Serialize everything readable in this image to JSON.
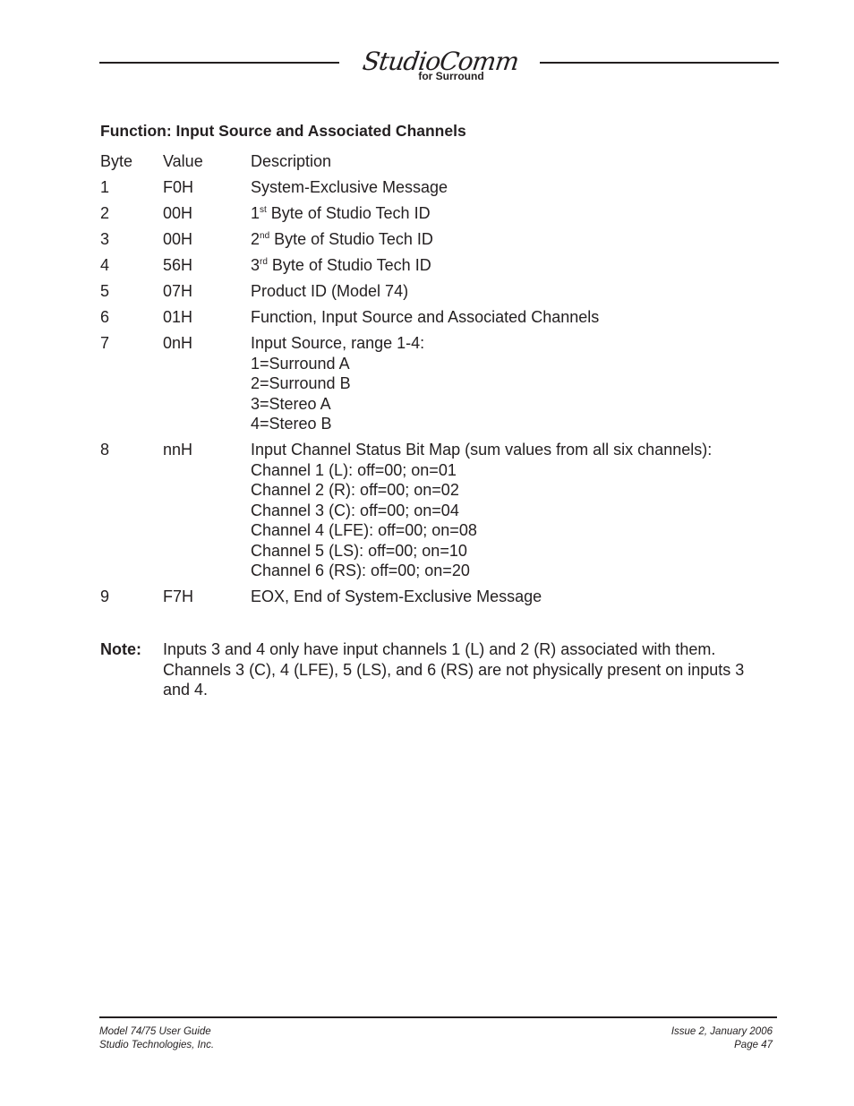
{
  "header": {
    "logo_script": "StudioComm",
    "logo_sub": "for Surround"
  },
  "section_title": "Function: Input Source and Associated Channels",
  "table": {
    "headers": {
      "byte": "Byte",
      "value": "Value",
      "description": "Description"
    },
    "rows": [
      {
        "byte": "1",
        "value": "F0H",
        "lines": [
          "System-Exclusive Message"
        ]
      },
      {
        "byte": "2",
        "value": "00H",
        "prefix": "1",
        "sup": "st",
        "lines": [
          " Byte of Studio Tech ID"
        ]
      },
      {
        "byte": "3",
        "value": "00H",
        "prefix": "2",
        "sup": "nd",
        "lines": [
          " Byte of Studio Tech ID"
        ]
      },
      {
        "byte": "4",
        "value": "56H",
        "prefix": "3",
        "sup": "rd",
        "lines": [
          " Byte of Studio Tech ID"
        ]
      },
      {
        "byte": "5",
        "value": "07H",
        "lines": [
          "Product ID (Model 74)"
        ]
      },
      {
        "byte": "6",
        "value": "01H",
        "lines": [
          "Function, Input Source and Associated Channels"
        ]
      },
      {
        "byte": "7",
        "value": "0nH",
        "lines": [
          "Input Source, range 1-4:",
          "1=Surround A",
          "2=Surround B",
          "3=Stereo A",
          "4=Stereo B"
        ]
      },
      {
        "byte": "8",
        "value": "nnH",
        "lines": [
          "Input Channel Status Bit Map (sum values from all six channels):",
          "Channel 1 (L): off=00; on=01",
          "Channel 2 (R): off=00; on=02",
          "Channel 3 (C): off=00; on=04",
          "Channel 4 (LFE): off=00; on=08",
          "Channel 5 (LS): off=00; on=10",
          "Channel 6 (RS): off=00; on=20"
        ]
      },
      {
        "byte": "9",
        "value": "F7H",
        "lines": [
          "EOX, End of System-Exclusive Message"
        ]
      }
    ]
  },
  "note": {
    "label": "Note:",
    "text": "Inputs 3 and 4 only have input channels 1 (L) and 2 (R) associated with them. Channels 3 (C), 4 (LFE), 5 (LS), and 6 (RS) are not physically present on inputs 3 and 4."
  },
  "footer": {
    "left_line1": "Model 74/75 User Guide",
    "left_line2": "Studio Technologies, Inc.",
    "right_line1": "Issue 2, January 2006",
    "right_line2": "Page 47"
  }
}
